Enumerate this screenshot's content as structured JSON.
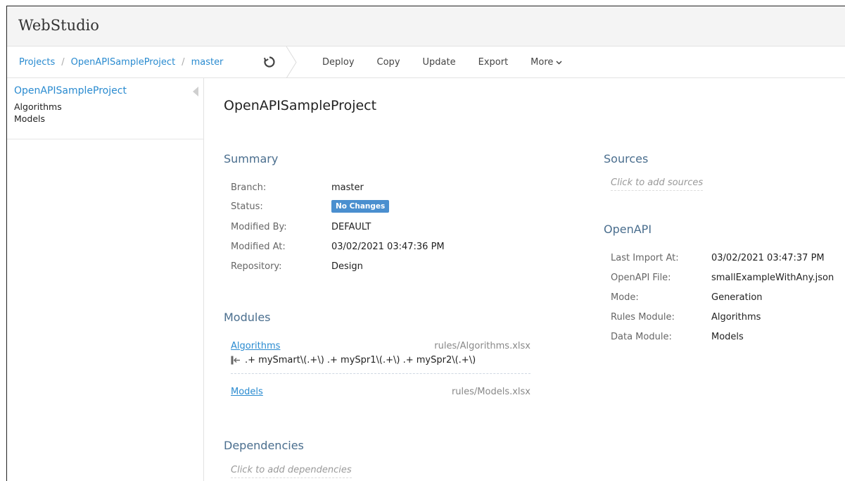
{
  "app": {
    "title": "WebStudio"
  },
  "breadcrumb": {
    "projects": "Projects",
    "project": "OpenAPISampleProject",
    "branch": "master",
    "sep": "/"
  },
  "toolbar": {
    "deploy": "Deploy",
    "copy": "Copy",
    "update": "Update",
    "export": "Export",
    "more": "More"
  },
  "sidebar": {
    "project": "OpenAPISampleProject",
    "modules": [
      "Algorithms",
      "Models"
    ]
  },
  "main": {
    "title": "OpenAPISampleProject",
    "summary": {
      "title": "Summary",
      "rows": [
        {
          "label": "Branch:",
          "value": "master"
        },
        {
          "label": "Status:",
          "value": "No Changes"
        },
        {
          "label": "Modified By:",
          "value": "DEFAULT"
        },
        {
          "label": "Modified At:",
          "value": "03/02/2021 03:47:36 PM"
        },
        {
          "label": "Repository:",
          "value": "Design"
        }
      ]
    },
    "modules": {
      "title": "Modules",
      "items": [
        {
          "name": "Algorithms",
          "path": "rules/Algorithms.xlsx",
          "signature": ".+ mySmart\\(.+\\) .+ mySpr1\\(.+\\) .+ mySpr2\\(.+\\)"
        },
        {
          "name": "Models",
          "path": "rules/Models.xlsx"
        }
      ]
    },
    "dependencies": {
      "title": "Dependencies",
      "placeholder": "Click to add dependencies"
    },
    "sources": {
      "title": "Sources",
      "placeholder": "Click to add sources"
    },
    "openapi": {
      "title": "OpenAPI",
      "rows": [
        {
          "label": "Last Import At:",
          "value": "03/02/2021 03:47:37 PM"
        },
        {
          "label": "OpenAPI File:",
          "value": "smallExampleWithAny.json"
        },
        {
          "label": "Mode:",
          "value": "Generation"
        },
        {
          "label": "Rules Module:",
          "value": "Algorithms"
        },
        {
          "label": "Data Module:",
          "value": "Models"
        }
      ]
    }
  },
  "colors": {
    "link": "#2a8bd0",
    "section": "#4a6e8e",
    "badge": "#4a8fcf"
  }
}
